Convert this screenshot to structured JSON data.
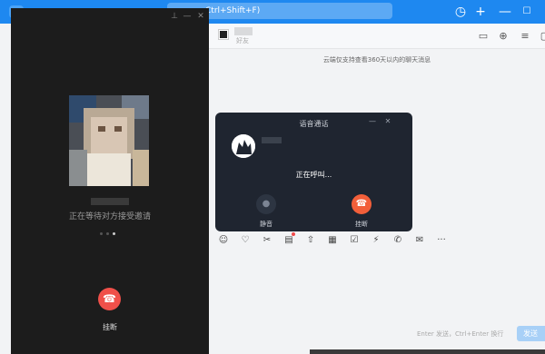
{
  "search": {
    "hint": "Ctrl+Shift+F)"
  },
  "chat": {
    "friend_tag": "好友",
    "history_note": "云端仅支持查看360天以内的聊天消息"
  },
  "call_window": {
    "waiting_text": "正在等待对方接受邀请",
    "hangup_label": "挂断"
  },
  "voice_call": {
    "title": "语音通话",
    "status": "正在呼叫...",
    "mute_label": "静音",
    "hangup_label": "挂断"
  },
  "input": {
    "send_hint": "Enter 发送，Ctrl+Enter 换行",
    "send_label": "发送"
  },
  "colors": {
    "brand_blue": "#1e88f0",
    "hangup_red": "#f0504a",
    "call_bg": "#1c1c1c",
    "voice_bg": "#1f2530"
  }
}
